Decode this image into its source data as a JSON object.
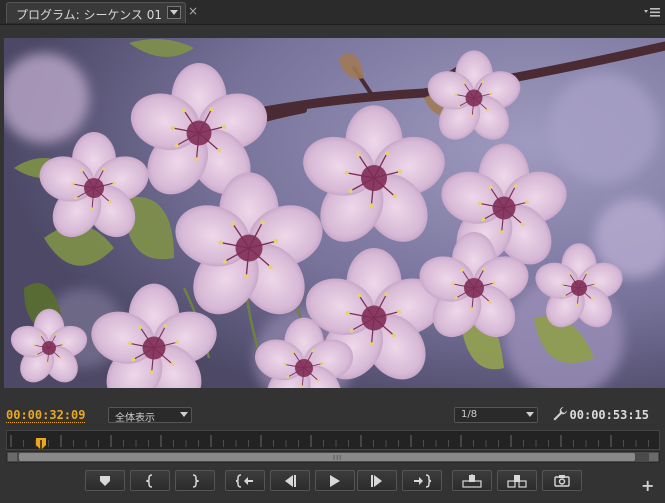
{
  "panel": {
    "tab_title": "プログラム: シーケンス 01",
    "close_glyph": "×"
  },
  "timecode": {
    "current": "00:00:32:09",
    "duration": "00:00:53:15"
  },
  "zoom_select": {
    "value": "全体表示"
  },
  "resolution_select": {
    "value": "1/8"
  },
  "timeline": {
    "playhead_fraction": 0.05,
    "scroll_grip": "III"
  },
  "transport": [
    {
      "id": "add-marker-button",
      "icon": "marker-icon"
    },
    {
      "id": "mark-in-button",
      "icon": "mark-in-icon"
    },
    {
      "id": "mark-out-button",
      "icon": "mark-out-icon"
    },
    {
      "id": "go-to-in-button",
      "icon": "go-to-in-icon"
    },
    {
      "id": "step-back-button",
      "icon": "step-back-icon"
    },
    {
      "id": "play-button",
      "icon": "play-icon"
    },
    {
      "id": "step-forward-button",
      "icon": "step-forward-icon"
    },
    {
      "id": "go-to-out-button",
      "icon": "go-to-out-icon"
    },
    {
      "id": "lift-button",
      "icon": "lift-icon"
    },
    {
      "id": "extract-button",
      "icon": "extract-icon"
    },
    {
      "id": "export-frame-button",
      "icon": "camera-icon"
    }
  ],
  "add_button_glyph": "+",
  "colors": {
    "current_timecode": "#e8a825",
    "panel_bg": "#333333",
    "blossom": "#d7b9d6"
  }
}
